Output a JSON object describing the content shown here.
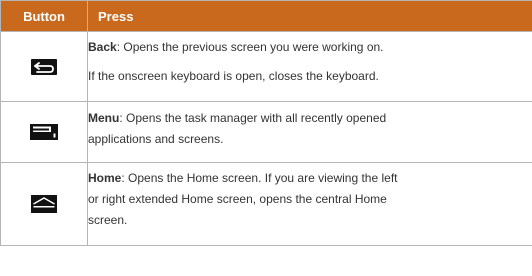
{
  "headers": {
    "button": "Button",
    "press": "Press"
  },
  "rows": [
    {
      "icon": "back-icon",
      "name": "Back",
      "text": ": Opens the previous screen you were working on.",
      "extra": "If the onscreen keyboard is open, closes the keyboard."
    },
    {
      "icon": "menu-icon",
      "name": "Menu",
      "text1": ": Opens the task manager with all recently opened",
      "text2": "applications and screens."
    },
    {
      "icon": "home-icon",
      "name": "Home",
      "text1": ": Opens the Home screen. If you are viewing the left",
      "text2": "or right extended Home screen, opens the central Home",
      "text3": "screen."
    }
  ]
}
